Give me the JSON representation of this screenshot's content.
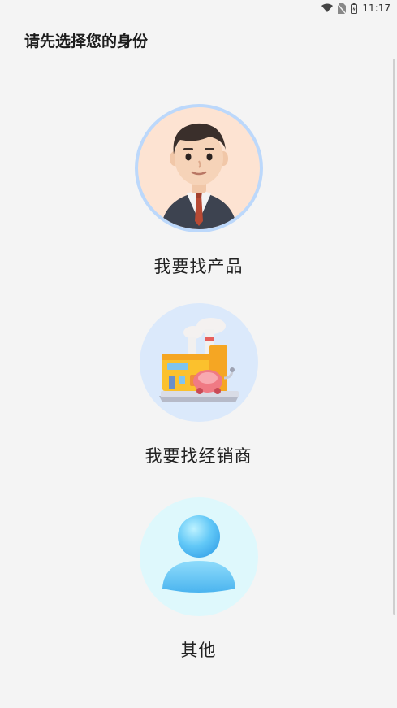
{
  "status_bar": {
    "time": "11:17",
    "icons": [
      "wifi-icon",
      "no-sim-icon",
      "battery-icon"
    ]
  },
  "header": {
    "title": "请先选择您的身份"
  },
  "options": [
    {
      "label": "我要找产品",
      "icon": "businessman-avatar-icon",
      "ring_color": "#bcd8fb"
    },
    {
      "label": "我要找经销商",
      "icon": "factory-building-icon",
      "bg_color": "#dbe9fb"
    },
    {
      "label": "其他",
      "icon": "generic-user-icon",
      "bg_color": "#def8fc"
    }
  ]
}
